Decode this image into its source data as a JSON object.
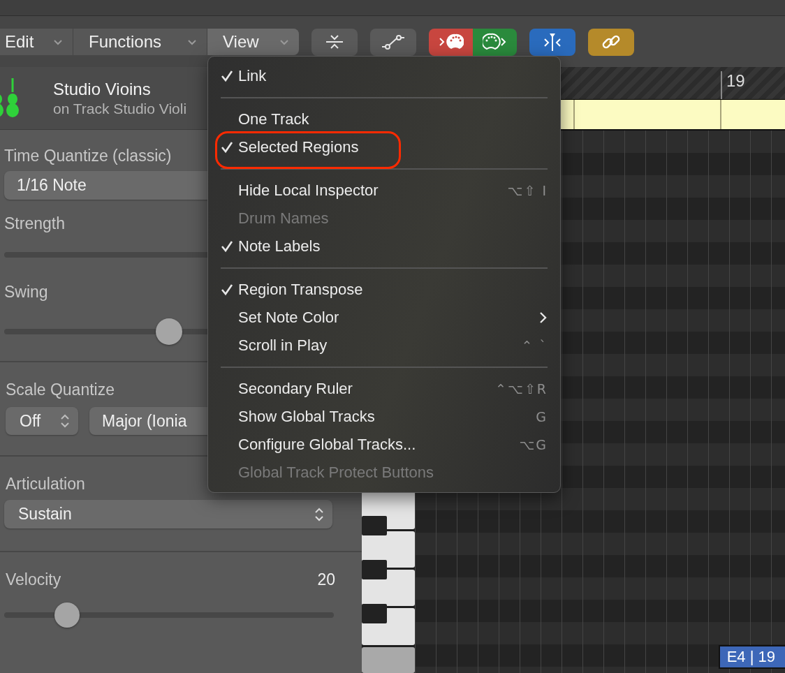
{
  "toolbar": {
    "menus": [
      {
        "label": "Edit",
        "selected": false
      },
      {
        "label": "Functions",
        "selected": false
      },
      {
        "label": "View",
        "selected": true
      }
    ],
    "icon_buttons": [
      {
        "kind": "collapse"
      },
      {
        "kind": "automation"
      },
      {
        "kind": "midi_in",
        "color": "#c8463f"
      },
      {
        "kind": "midi_out",
        "color": "#2a8a3c"
      },
      {
        "kind": "catch",
        "color": "#2a6bbd"
      },
      {
        "kind": "link",
        "color": "#b58a2a"
      }
    ]
  },
  "inspector": {
    "track": {
      "name": "Studio Vioins",
      "subtitle": "on Track Studio Violi"
    },
    "time_quantize": {
      "label": "Time Quantize (classic)",
      "value": "1/16 Note"
    },
    "strength": {
      "label": "Strength"
    },
    "swing": {
      "label": "Swing",
      "level": 0.5
    },
    "scale_quantize": {
      "label": "Scale Quantize",
      "mode": "Off",
      "scale": "Major (Ionia"
    },
    "articulation": {
      "label": "Articulation",
      "value": "Sustain"
    },
    "velocity": {
      "label": "Velocity",
      "value": "20",
      "level": 0.19
    }
  },
  "piano_roll": {
    "ruler_bar": "19",
    "position": "E4 | 19"
  },
  "view_menu": {
    "sections": [
      {
        "items": [
          {
            "label": "Link",
            "checked": true,
            "disabled": false,
            "submenu": false,
            "highlighted": false
          }
        ]
      },
      {
        "items": [
          {
            "label": "One Track",
            "checked": false,
            "disabled": false,
            "submenu": false,
            "highlighted": false
          },
          {
            "label": "Selected Regions",
            "checked": true,
            "disabled": false,
            "submenu": false,
            "highlighted": true
          }
        ]
      },
      {
        "items": [
          {
            "label": "Hide Local Inspector",
            "checked": false,
            "disabled": false,
            "submenu": false,
            "highlighted": false,
            "shortcut": "⌥⇧ I"
          },
          {
            "label": "Drum Names",
            "checked": false,
            "disabled": true,
            "submenu": false,
            "highlighted": false
          },
          {
            "label": "Note Labels",
            "checked": true,
            "disabled": false,
            "submenu": false,
            "highlighted": false
          }
        ]
      },
      {
        "items": [
          {
            "label": "Region Transpose",
            "checked": true,
            "disabled": false,
            "submenu": false,
            "highlighted": false
          },
          {
            "label": "Set Note Color",
            "checked": false,
            "disabled": false,
            "submenu": true,
            "highlighted": false
          },
          {
            "label": "Scroll in Play",
            "checked": false,
            "disabled": false,
            "submenu": false,
            "highlighted": false,
            "shortcut": "⌃ `"
          }
        ]
      },
      {
        "items": [
          {
            "label": "Secondary Ruler",
            "checked": false,
            "disabled": false,
            "submenu": false,
            "highlighted": false,
            "shortcut": "⌃⌥⇧R"
          },
          {
            "label": "Show Global Tracks",
            "checked": false,
            "disabled": false,
            "submenu": false,
            "highlighted": false,
            "shortcut": "G"
          },
          {
            "label": "Configure Global Tracks...",
            "checked": false,
            "disabled": false,
            "submenu": false,
            "highlighted": false,
            "shortcut": "⌥G"
          },
          {
            "label": "Global Track Protect Buttons",
            "checked": false,
            "disabled": true,
            "submenu": false,
            "highlighted": false
          }
        ]
      }
    ]
  }
}
